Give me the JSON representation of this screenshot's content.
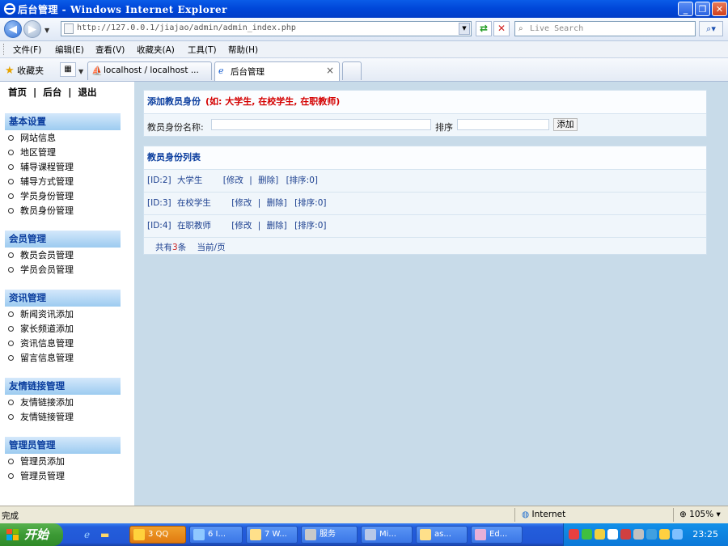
{
  "window": {
    "title": "后台管理 - Windows Internet Explorer"
  },
  "address_bar": {
    "url": "http://127.0.0.1/jiajao/admin/admin_index.php",
    "search_placeholder": "Live Search"
  },
  "menu": [
    "文件(F)",
    "编辑(E)",
    "查看(V)",
    "收藏夹(A)",
    "工具(T)",
    "帮助(H)"
  ],
  "favorites_label": "收藏夹",
  "tabs": [
    {
      "label": "localhost / localhost ..."
    },
    {
      "label": "后台管理",
      "close": "×"
    }
  ],
  "top_links": [
    "首页",
    "|",
    "后台",
    "|",
    "退出"
  ],
  "sidebar": [
    {
      "heading": "基本设置",
      "items": [
        "网站信息",
        "地区管理",
        "辅导课程管理",
        "辅导方式管理",
        "学员身份管理",
        "教员身份管理"
      ]
    },
    {
      "heading": "会员管理",
      "items": [
        "教员会员管理",
        "学员会员管理"
      ]
    },
    {
      "heading": "资讯管理",
      "items": [
        "新闻资讯添加",
        "家长频道添加",
        "资讯信息管理",
        "留言信息管理"
      ]
    },
    {
      "heading": "友情链接管理",
      "items": [
        "友情链接添加",
        "友情链接管理"
      ]
    },
    {
      "heading": "管理员管理",
      "items": [
        "管理员添加",
        "管理员管理"
      ]
    }
  ],
  "add_panel": {
    "title": "添加教员身份",
    "note": "(如: 大学生, 在校学生, 在职教师)",
    "name_label": "教员身份名称:",
    "name_value": "",
    "sort_label": "排序",
    "sort_value": "",
    "submit_label": "添加"
  },
  "list_panel": {
    "title": "教员身份列表",
    "rows": [
      {
        "id": "[ID:2]",
        "name": "大学生",
        "edit": "[修改",
        "sep": "|",
        "delete": "删除]",
        "sort": "[排序:0]"
      },
      {
        "id": "[ID:3]",
        "name": "在校学生",
        "edit": "[修改",
        "sep": "|",
        "delete": "删除]",
        "sort": "[排序:0]"
      },
      {
        "id": "[ID:4]",
        "name": "在职教师",
        "edit": "[修改",
        "sep": "|",
        "delete": "删除]",
        "sort": "[排序:0]"
      }
    ],
    "pager": {
      "prefix": "共有",
      "count": "3",
      "suffix": "条",
      "current": "当前/页"
    }
  },
  "status_bar": {
    "text": "完成",
    "zone": "Internet",
    "zoom": "105%"
  },
  "taskbar": {
    "start_label": "开始",
    "buttons": [
      "3 QQ",
      "6 I...",
      "7 W...",
      "服务",
      "Mi...",
      "as...",
      "Ed..."
    ],
    "clock": "23:25"
  },
  "colors": {
    "accent": "#0a3d9e",
    "note_red": "#d40000",
    "content_bg": "#c8dbe9",
    "section_head": "#9ccbf0"
  }
}
